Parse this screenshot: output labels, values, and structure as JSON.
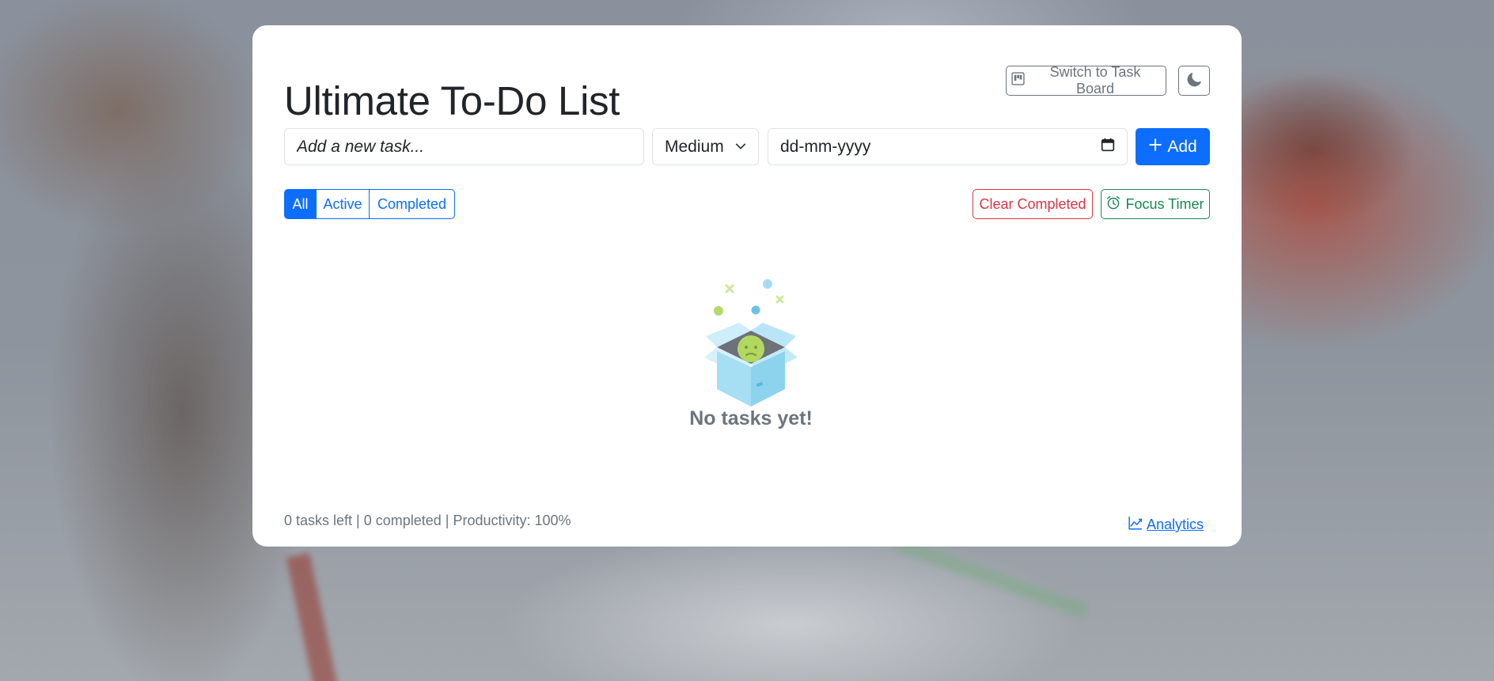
{
  "app": {
    "title": "Ultimate To-Do List"
  },
  "header": {
    "switch_label": "Switch to Task Board",
    "switch_icon": "kanban-icon",
    "theme_icon": "moon-icon"
  },
  "task_form": {
    "task_placeholder": "Add a new task...",
    "task_value": "",
    "priority_selected": "Medium",
    "date_placeholder": "dd-mm-yyyy",
    "add_label": "Add",
    "add_icon": "plus-icon"
  },
  "filters": {
    "items": [
      {
        "label": "All",
        "active": true
      },
      {
        "label": "Active",
        "active": false
      },
      {
        "label": "Completed",
        "active": false
      }
    ]
  },
  "actions": {
    "clear_label": "Clear Completed",
    "timer_label": "Focus Timer",
    "timer_icon": "alarm-icon"
  },
  "empty_state": {
    "message": "No tasks yet!"
  },
  "footer": {
    "tasks_left": "0 tasks left",
    "completed": "0 completed",
    "productivity": "Productivity: 100%",
    "separator": " | ",
    "analytics_label": "Analytics",
    "analytics_icon": "graph-up-icon"
  },
  "colors": {
    "primary": "#0d6efd",
    "danger": "#dc3545",
    "success": "#198754",
    "secondary": "#6c757d",
    "text": "#212529"
  }
}
